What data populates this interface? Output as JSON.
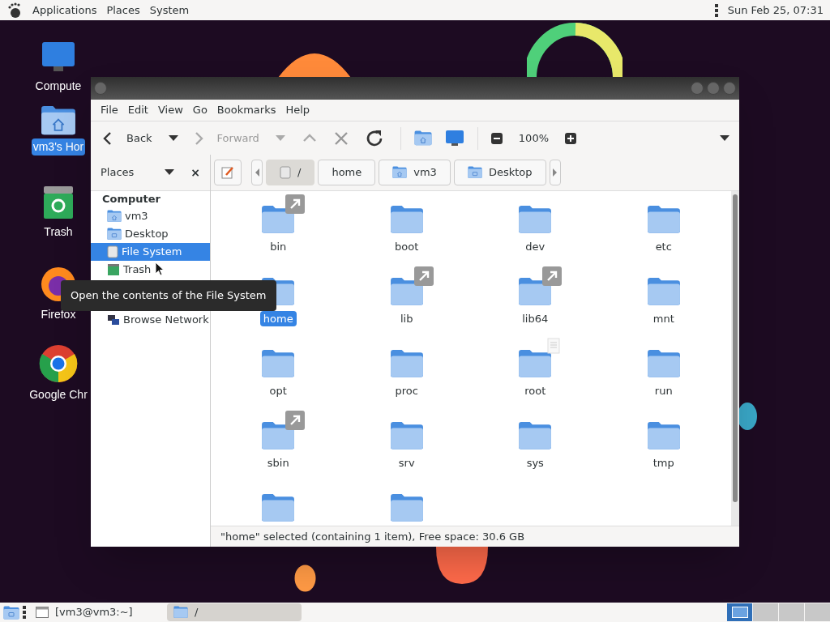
{
  "top_panel": {
    "menus": [
      "Applications",
      "Places",
      "System"
    ],
    "clock": "Sun Feb 25, 07:31"
  },
  "desktop_icons": [
    {
      "kind": "computer",
      "label": "Compute",
      "selected": false
    },
    {
      "kind": "home",
      "label": "vm3's Hor",
      "selected": true
    },
    {
      "kind": "trash",
      "label": "Trash",
      "selected": false
    },
    {
      "kind": "firefox",
      "label": "Firefox",
      "selected": false
    },
    {
      "kind": "chrome",
      "label": "Google Chr",
      "selected": false
    }
  ],
  "window": {
    "menu": [
      "File",
      "Edit",
      "View",
      "Go",
      "Bookmarks",
      "Help"
    ],
    "toolbar": {
      "back": "Back",
      "forward": "Forward",
      "forward_disabled": true,
      "zoom": "100%"
    },
    "location": [
      {
        "label": "/",
        "kind": "drive",
        "selected": true
      },
      {
        "label": "home",
        "kind": "plain",
        "selected": false
      },
      {
        "label": "vm3",
        "kind": "home",
        "selected": false
      },
      {
        "label": "Desktop",
        "kind": "desktop",
        "selected": false
      }
    ],
    "sidebar": {
      "title": "Places",
      "close": "×",
      "sections": [
        {
          "heading": "Computer",
          "items": [
            {
              "label": "vm3",
              "kind": "home",
              "selected": false
            },
            {
              "label": "Desktop",
              "kind": "desktop",
              "selected": false
            },
            {
              "label": "File System",
              "kind": "drive",
              "selected": true
            },
            {
              "label": "Trash",
              "kind": "trash",
              "selected": false
            }
          ]
        },
        {
          "items": [
            {
              "label": "Browse Network",
              "kind": "network",
              "selected": false
            }
          ]
        }
      ]
    },
    "tooltip": "Open the contents of the File System",
    "files": [
      {
        "name": "bin",
        "kind": "link",
        "selected": false
      },
      {
        "name": "boot",
        "kind": "plain",
        "selected": false
      },
      {
        "name": "dev",
        "kind": "plain",
        "selected": false
      },
      {
        "name": "etc",
        "kind": "plain",
        "selected": false
      },
      {
        "name": "home",
        "kind": "plain",
        "selected": true
      },
      {
        "name": "lib",
        "kind": "link",
        "selected": false
      },
      {
        "name": "lib64",
        "kind": "link",
        "selected": false
      },
      {
        "name": "mnt",
        "kind": "plain",
        "selected": false
      },
      {
        "name": "opt",
        "kind": "plain",
        "selected": false
      },
      {
        "name": "proc",
        "kind": "plain",
        "selected": false
      },
      {
        "name": "root",
        "kind": "document",
        "selected": false
      },
      {
        "name": "run",
        "kind": "plain",
        "selected": false
      },
      {
        "name": "sbin",
        "kind": "link",
        "selected": false
      },
      {
        "name": "srv",
        "kind": "plain",
        "selected": false
      },
      {
        "name": "sys",
        "kind": "plain",
        "selected": false
      },
      {
        "name": "tmp",
        "kind": "plain",
        "selected": false
      },
      {
        "kind": "plain"
      },
      {
        "kind": "plain"
      }
    ],
    "status": "\"home\" selected (containing 1 item), Free space: 30.6 GB"
  },
  "taskbar": {
    "tasks": [
      {
        "label": "[vm3@vm3:~]",
        "kind": "terminal",
        "selected": false
      },
      {
        "label": "/",
        "kind": "folder",
        "selected": true
      }
    ],
    "workspaces": [
      {
        "selected": true
      },
      {
        "selected": false
      },
      {
        "selected": false
      },
      {
        "selected": false
      }
    ]
  }
}
